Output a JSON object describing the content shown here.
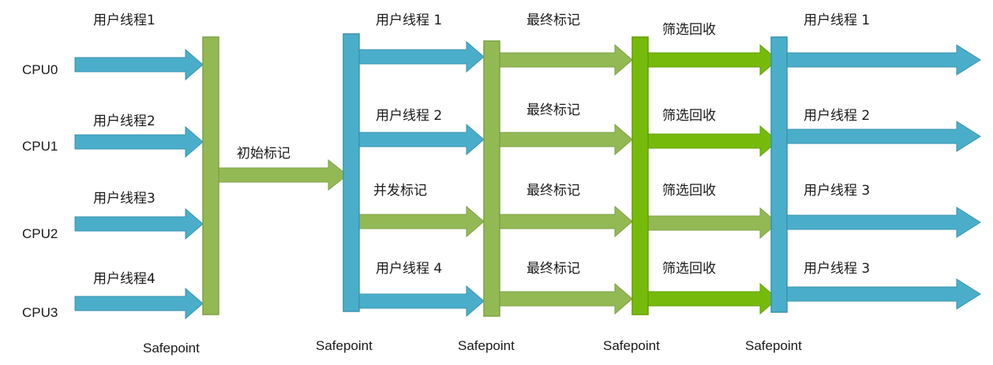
{
  "colors": {
    "blue": "#4aaecb",
    "blue_edge": "#3b93ad",
    "green_light": "#93b955",
    "green_light_edge": "#7ea244",
    "green_bright": "#76bb0c",
    "green_bright_edge": "#62a000"
  },
  "cpus": [
    "CPU0",
    "CPU1",
    "CPU2",
    "CPU3"
  ],
  "phase1_labels": [
    "用户线程1",
    "用户线程2",
    "用户线程3",
    "用户线程4"
  ],
  "initial_mark": "初始标记",
  "phase2_labels": [
    "用户线程 1",
    "用户线程 2",
    "并发标记",
    "用户线程 4"
  ],
  "phase3_labels": [
    "最终标记",
    "最终标记",
    "最终标记",
    "最终标记"
  ],
  "phase4_labels": [
    "筛选回收",
    "筛选回收",
    "筛选回收",
    "筛选回收"
  ],
  "phase5_labels": [
    "用户线程 1",
    "用户线程 2",
    "用户线程 3",
    "用户线程 3"
  ],
  "safepoints": [
    "Safepoint",
    "Safepoint",
    "Safepoint",
    "Safepoint",
    "Safepoint"
  ]
}
